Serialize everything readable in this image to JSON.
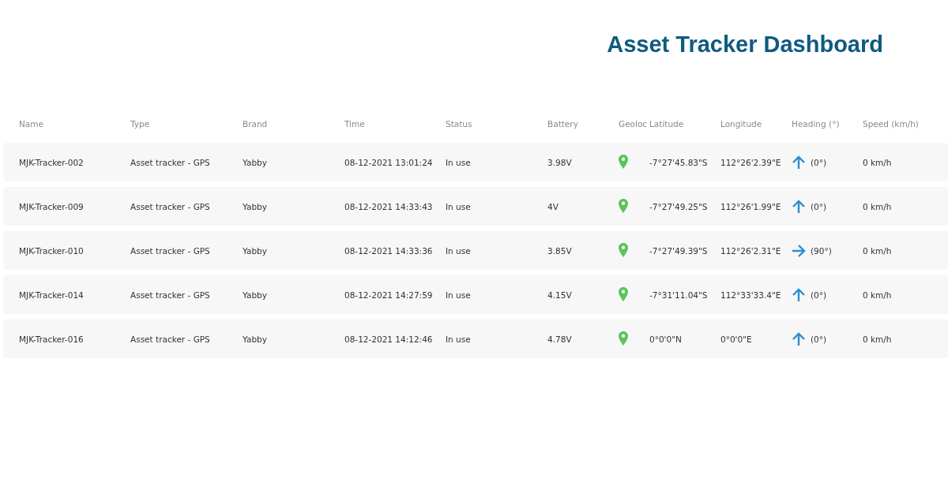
{
  "title": "Asset Tracker Dashboard",
  "table": {
    "columns": [
      "Name",
      "Type",
      "Brand",
      "Time",
      "Status",
      "Battery",
      "Geoloc",
      "Latitude",
      "Longitude",
      "Heading (°)",
      "Speed (km/h)"
    ],
    "rows": [
      {
        "name": "MJK-Tracker-002",
        "type": "Asset tracker - GPS",
        "brand": "Yabby",
        "time": "08-12-2021 13:01:24",
        "status": "In use",
        "battery": "3.98V",
        "latitude": "-7°27'45.83\"S",
        "longitude": "112°26'2.39\"E",
        "kind": "up",
        "heading": "(0°)",
        "speed": "0 km/h"
      },
      {
        "name": "MJK-Tracker-009",
        "type": "Asset tracker - GPS",
        "brand": "Yabby",
        "time": "08-12-2021 14:33:43",
        "status": "In use",
        "battery": "4V",
        "latitude": "-7°27'49.25\"S",
        "longitude": "112°26'1.99\"E",
        "kind": "up",
        "heading": "(0°)",
        "speed": "0 km/h"
      },
      {
        "name": "MJK-Tracker-010",
        "type": "Asset tracker - GPS",
        "brand": "Yabby",
        "time": "08-12-2021 14:33:36",
        "status": "In use",
        "battery": "3.85V",
        "latitude": "-7°27'49.39\"S",
        "longitude": "112°26'2.31\"E",
        "kind": "right",
        "heading": "(90°)",
        "speed": "0 km/h"
      },
      {
        "name": "MJK-Tracker-014",
        "type": "Asset tracker - GPS",
        "brand": "Yabby",
        "time": "08-12-2021 14:27:59",
        "status": "In use",
        "battery": "4.15V",
        "latitude": "-7°31'11.04\"S",
        "longitude": "112°33'33.4\"E",
        "kind": "up",
        "heading": "(0°)",
        "speed": "0 km/h"
      },
      {
        "name": "MJK-Tracker-016",
        "type": "Asset tracker - GPS",
        "brand": "Yabby",
        "time": "08-12-2021 14:12:46",
        "status": "In use",
        "battery": "4.78V",
        "latitude": "0°0'0\"N",
        "longitude": "0°0'0\"E",
        "kind": "up",
        "heading": "(0°)",
        "speed": "0 km/h"
      }
    ]
  }
}
